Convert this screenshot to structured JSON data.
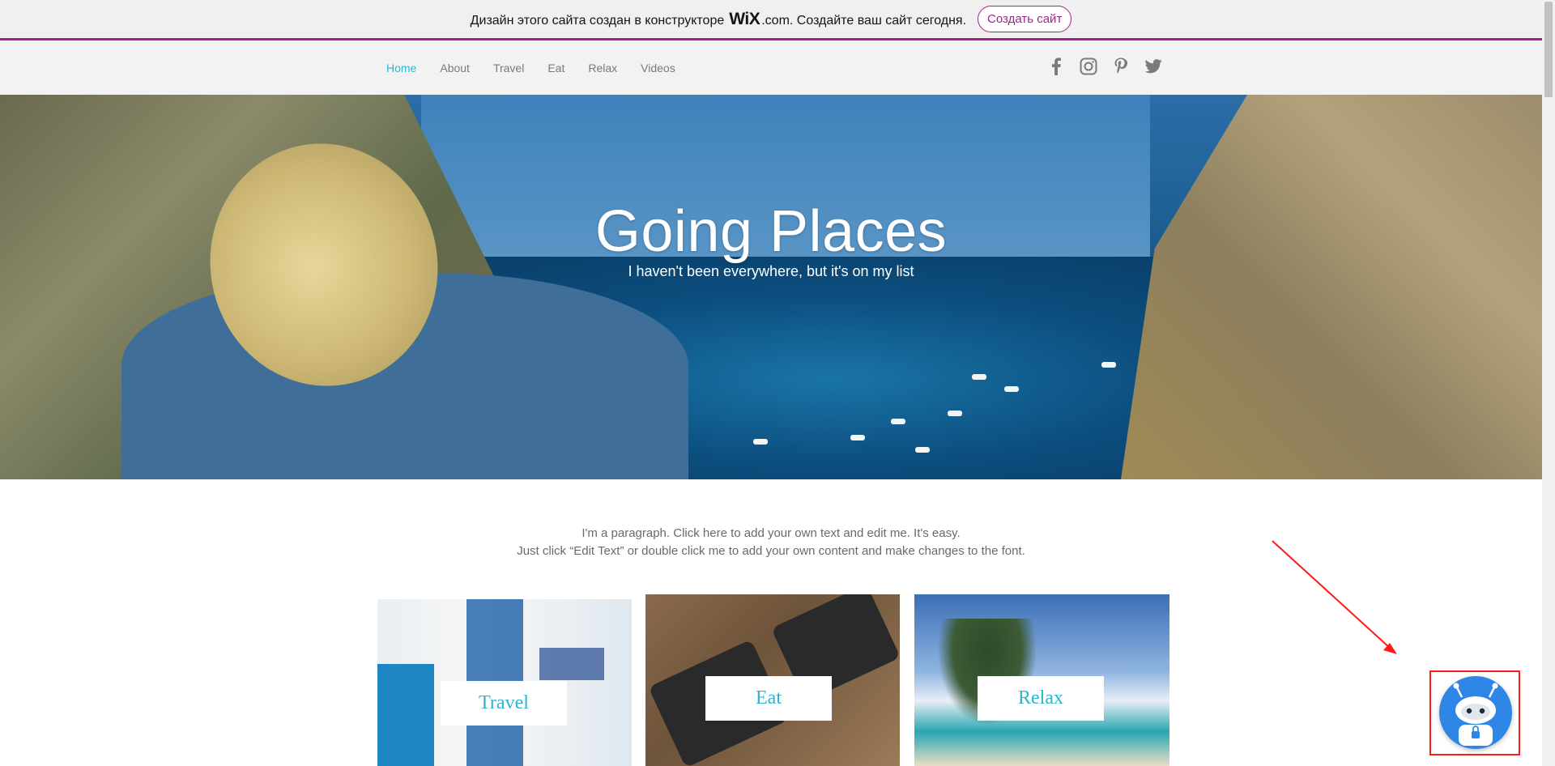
{
  "promo": {
    "text_before": "Дизайн этого сайта создан в конструкторе ",
    "logo": "WiX",
    "text_after": ".com. Создайте ваш сайт сегодня.",
    "button_label": "Создать сайт",
    "accent_color": "#a2238e"
  },
  "nav": {
    "items": [
      {
        "label": "Home",
        "active": true
      },
      {
        "label": "About",
        "active": false
      },
      {
        "label": "Travel",
        "active": false
      },
      {
        "label": "Eat",
        "active": false
      },
      {
        "label": "Relax",
        "active": false
      },
      {
        "label": "Videos",
        "active": false
      }
    ],
    "active_color": "#2fb4cf"
  },
  "social": [
    "facebook-icon",
    "instagram-icon",
    "pinterest-icon",
    "twitter-icon"
  ],
  "hero": {
    "title": "Going Places",
    "subtitle": "I haven't been everywhere, but it's on my list"
  },
  "paragraph": {
    "line1": "I'm a paragraph. Click here to add your own text and edit me. It's easy.",
    "line2": "Just click “Edit Text” or double click me to add your own content and make changes to the font."
  },
  "cards": {
    "travel": "Travel",
    "eat": "Eat",
    "relax": "Relax"
  },
  "chatbot": {
    "icon": "robot-icon",
    "color": "#2e86e6"
  }
}
